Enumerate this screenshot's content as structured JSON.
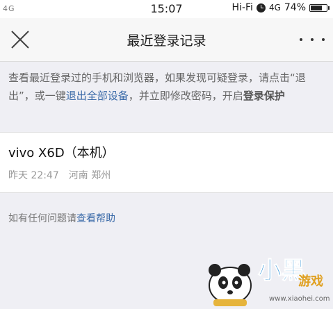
{
  "status_bar": {
    "network": "4G",
    "time": "15:07",
    "wifi": "Hi-Fi",
    "cell": "4G",
    "battery": "74%",
    "battery_level": 0.74
  },
  "navbar": {
    "title": "最近登录记录",
    "close_icon": "close-icon",
    "more_icon": "more-icon"
  },
  "notice": {
    "text_1": "查看最近登录过的手机和浏览器，如果发现可疑登录，请点击“退出”，或一键",
    "link": "退出全部设备",
    "text_2": "，并立即修改密码，开启",
    "emphasis": "登录保护"
  },
  "records": [
    {
      "device": "vivo X6D（本机）",
      "time": "昨天 22:47",
      "location": "河南 郑州"
    }
  ],
  "help": {
    "prefix": "如有任何问题请",
    "link": "查看帮助"
  },
  "watermark": {
    "brand": "小黑游戏",
    "url": "www.xiaohei.com"
  }
}
